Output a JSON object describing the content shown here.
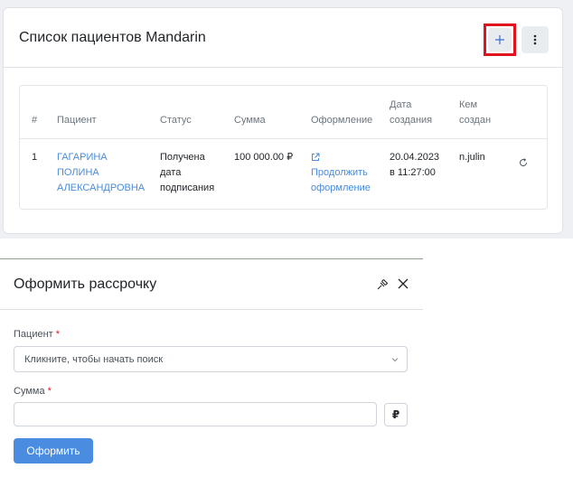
{
  "patient_list": {
    "title": "Список пациентов Mandarin",
    "add_button_icon": "plus-icon",
    "more_button_icon": "vertical-dots-icon",
    "highlight_color": "#e0141e",
    "columns": {
      "num": "#",
      "patient": "Пациент",
      "status": "Статус",
      "amount": "Сумма",
      "processing": "Оформление",
      "created_line1": "Дата",
      "created_line2": "создания",
      "creator_line1": "Кем",
      "creator_line2": "создан"
    },
    "rows": [
      {
        "num": "1",
        "patient_line1": "ГАГАРИНА",
        "patient_line2": "ПОЛИНА",
        "patient_line3": "АЛЕКСАНДРОВНА",
        "status_line1": "Получена",
        "status_line2": "дата",
        "status_line3": "подписания",
        "amount": "100 000.00 ₽",
        "processing_icon": "external-link-icon",
        "processing_line1": "Продолжить",
        "processing_line2": "оформление",
        "created_line1": "20.04.2023",
        "created_line2": "в 11:27:00",
        "creator": "n.julin",
        "refresh_icon": "refresh-icon"
      }
    ]
  },
  "installment_form": {
    "title": "Оформить рассрочку",
    "pin_icon": "pin-icon",
    "close_icon": "close-icon",
    "patient_label": "Пациент",
    "required_mark": "*",
    "patient_placeholder": "Кликните, чтобы начать поиск",
    "amount_label": "Сумма",
    "amount_value": "",
    "currency_symbol": "₽",
    "submit_label": "Оформить",
    "accent_color": "#4a8cdf"
  }
}
